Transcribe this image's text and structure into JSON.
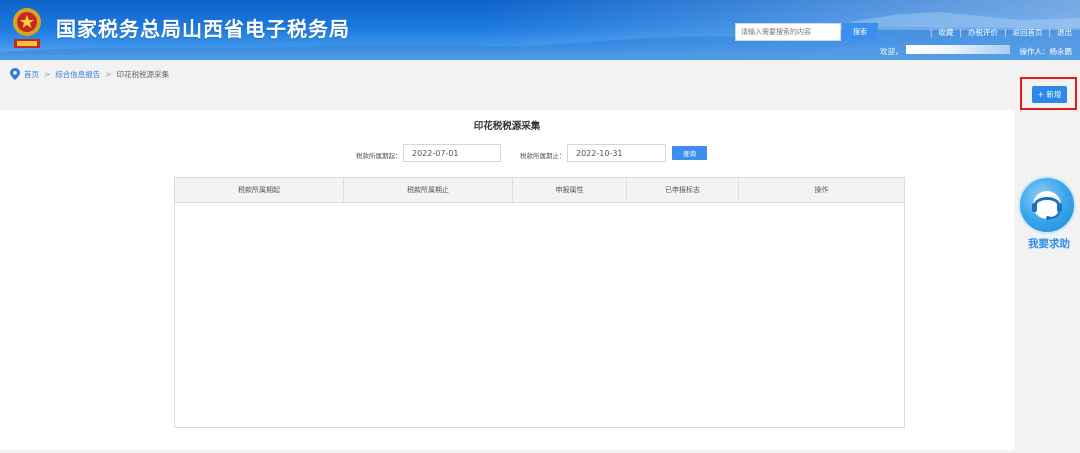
{
  "header": {
    "site_title": "国家税务总局山西省电子税务局",
    "search_placeholder": "请输入需要搜索的内容",
    "search_button": "搜索",
    "links": [
      "收藏",
      "办税评价",
      "返回首页",
      "退出"
    ],
    "welcome_label": "欢迎，",
    "operator_label": "操作人：杨永鹏"
  },
  "breadcrumb": {
    "home": "首页",
    "section": "综合信息报告",
    "current": "印花税税源采集",
    "separator": ">"
  },
  "toolbar": {
    "add_button": "+ 新增"
  },
  "page": {
    "title": "印花税税源采集"
  },
  "filters": {
    "start_label": "税款所属期起：",
    "start_value": "2022-07-01",
    "end_label": "税款所属期止：",
    "end_value": "2022-10-31",
    "query_button": "查询"
  },
  "table": {
    "columns": [
      "税款所属期起",
      "税款所属期止",
      "申报属性",
      "已申报标志",
      "操作"
    ],
    "rows": []
  },
  "help": {
    "label": "我要求助"
  },
  "colors": {
    "brand_blue": "#1b79de",
    "highlight_red": "#e02020",
    "button_blue": "#2f87ea"
  }
}
